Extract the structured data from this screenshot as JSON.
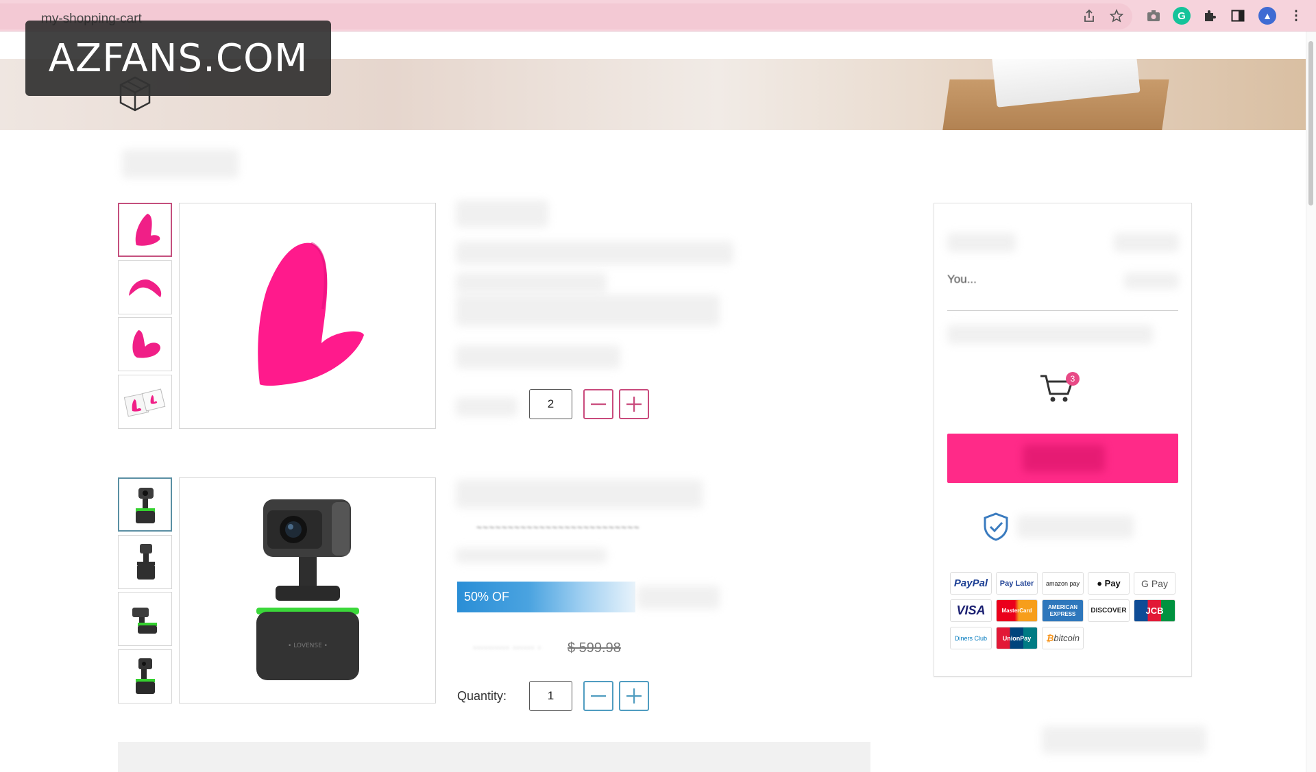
{
  "browser": {
    "url": "my-shopping-cart",
    "icons": [
      "share-icon",
      "star-icon",
      "camera-icon",
      "grammarly-icon",
      "puzzle-icon",
      "sidebar-icon",
      "profile-avatar",
      "kebab-menu-icon"
    ]
  },
  "watermark": {
    "text": "AZFANS.COM"
  },
  "cart": {
    "items": [
      {
        "quantity": "2",
        "thumbnails": 4,
        "active_thumbnail_color": "#c44f7d"
      },
      {
        "quantity": "1",
        "thumbnails": 4,
        "active_thumbnail_color": "#5a8fa3",
        "quantity_label": "Quantity:",
        "discount_badge": "50% OF",
        "old_price": "$ 599.98"
      }
    ]
  },
  "summary": {
    "you_text": "You...",
    "cart_count": "3",
    "checkout_color": "#ff2a88",
    "payment_methods": [
      "PayPal",
      "Pay Later",
      "amazon pay",
      "Pay",
      "G Pay",
      "VISA",
      "MasterCard",
      "AMERICAN EXPRESS",
      "DISCOVER",
      "JCB",
      "Diners Club",
      "UnionPay",
      "bitcoin"
    ]
  },
  "colors": {
    "accent_pink": "#ff2a88",
    "product_pink": "#ff1a8c",
    "qty_teal": "#4f9cc0"
  }
}
